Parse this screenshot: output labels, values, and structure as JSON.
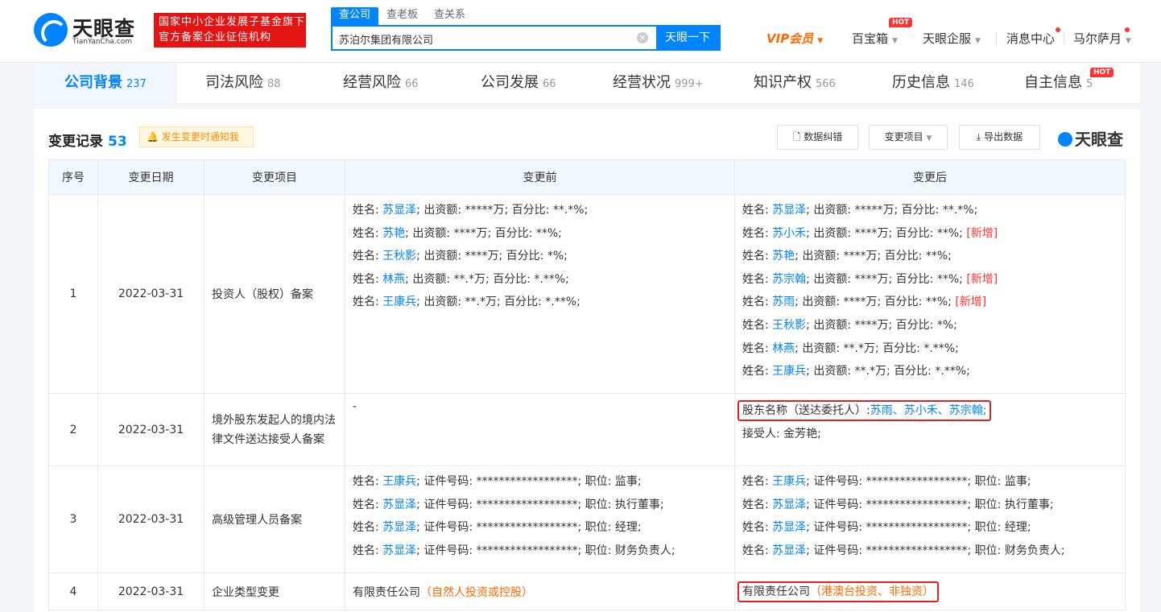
{
  "header": {
    "logo_text": "天眼查",
    "logo_sub": "TianYanCha.com",
    "banner_line1": "国家中小企业发展子基金旗下",
    "banner_line2": "官方备案企业征信机构",
    "search_tabs": [
      "查公司",
      "查老板",
      "查关系"
    ],
    "search_value": "苏泊尔集团有限公司",
    "search_button": "天眼一下",
    "nav": {
      "vip": "VIP会员",
      "treasure": "百宝箱",
      "treasure_badge": "HOT",
      "enterprise": "天眼企服",
      "messages": "消息中心",
      "user": "马尔萨月"
    }
  },
  "tabs": [
    {
      "label": "公司背景",
      "count": "237"
    },
    {
      "label": "司法风险",
      "count": "88"
    },
    {
      "label": "经营风险",
      "count": "66"
    },
    {
      "label": "公司发展",
      "count": "66"
    },
    {
      "label": "经营状况",
      "count": "999+"
    },
    {
      "label": "知识产权",
      "count": "566"
    },
    {
      "label": "历史信息",
      "count": "146"
    },
    {
      "label": "自主信息",
      "count": "5",
      "badge": "HOT"
    }
  ],
  "section": {
    "title": "变更记录",
    "count": "53",
    "notify": "发生变更时通知我",
    "btn_correct": "数据纠错",
    "btn_filter": "变更项目",
    "btn_export": "导出数据",
    "watermark": "天眼查"
  },
  "table": {
    "headers": [
      "序号",
      "变更日期",
      "变更项目",
      "变更前",
      "变更后"
    ],
    "rows": [
      {
        "no": "1",
        "date": "2022-03-31",
        "item": "投资人（股权）备案"
      },
      {
        "no": "2",
        "date": "2022-03-31",
        "item": "境外股东发起人的境内法律文件送达接受人备案"
      },
      {
        "no": "3",
        "date": "2022-03-31",
        "item": "高级管理人员备案"
      },
      {
        "no": "4",
        "date": "2022-03-31",
        "item": "企业类型变更"
      }
    ],
    "r1_before": [
      {
        "name": "苏显泽",
        "amount": "*****万",
        "pct": "**.*%"
      },
      {
        "name": "苏艳",
        "amount": "****万",
        "pct": "**%"
      },
      {
        "name": "王秋影",
        "amount": "****万",
        "pct": "*%"
      },
      {
        "name": "林燕",
        "amount": "**.*万",
        "pct": "*.**%"
      },
      {
        "name": "王康兵",
        "amount": "**.*万",
        "pct": "*.**%"
      }
    ],
    "r1_after": [
      {
        "name": "苏显泽",
        "amount": "*****万",
        "pct": "**.*%",
        "tag": ""
      },
      {
        "name": "苏小禾",
        "amount": "****万",
        "pct": "**%",
        "tag": "[新增]"
      },
      {
        "name": "苏艳",
        "amount": "****万",
        "pct": "**%",
        "tag": ""
      },
      {
        "name": "苏宗翰",
        "amount": "****万",
        "pct": "**%",
        "tag": "[新增]"
      },
      {
        "name": "苏雨",
        "amount": "****万",
        "pct": "**%",
        "tag": "[新增]"
      },
      {
        "name": "王秋影",
        "amount": "****万",
        "pct": "*%",
        "tag": ""
      },
      {
        "name": "林燕",
        "amount": "**.*万",
        "pct": "*.**%",
        "tag": ""
      },
      {
        "name": "王康兵",
        "amount": "**.*万",
        "pct": "*.**%",
        "tag": ""
      }
    ],
    "r2_before": "-",
    "r2_after": {
      "label": "股东名称（送达委托人）:",
      "names": [
        "苏雨",
        "苏小禾",
        "苏宗翰"
      ],
      "receiver_label": "接受人:",
      "receiver": "金芳艳;"
    },
    "r3_before": [
      {
        "name": "王康兵",
        "id": "******************",
        "role": "监事"
      },
      {
        "name": "苏显泽",
        "id": "******************",
        "role": "执行董事"
      },
      {
        "name": "苏显泽",
        "id": "******************",
        "role": "经理"
      },
      {
        "name": "苏显泽",
        "id": "******************",
        "role": "财务负责人"
      }
    ],
    "r3_after": [
      {
        "name": "王康兵",
        "id": "******************",
        "role": "监事"
      },
      {
        "name": "苏显泽",
        "id": "******************",
        "role": "执行董事"
      },
      {
        "name": "苏显泽",
        "id": "******************",
        "role": "经理"
      },
      {
        "name": "苏显泽",
        "id": "******************",
        "role": "财务负责人"
      }
    ],
    "r4_before": {
      "type": "有限责任公司",
      "note": "（自然人投资或控股）"
    },
    "r4_after": {
      "type": "有限责任公司",
      "note": "（港澳台投资、非独资）"
    }
  },
  "labels": {
    "name": "姓名: ",
    "amount": "; 出资额: ",
    "pct": "; 百分比: ",
    "id": "; 证件号码: ",
    "role": "; 职位: "
  },
  "colors": {
    "accent": "#0084ff",
    "highlight": "#e02222",
    "note": "#ff6a00",
    "new": "#ff3333"
  }
}
